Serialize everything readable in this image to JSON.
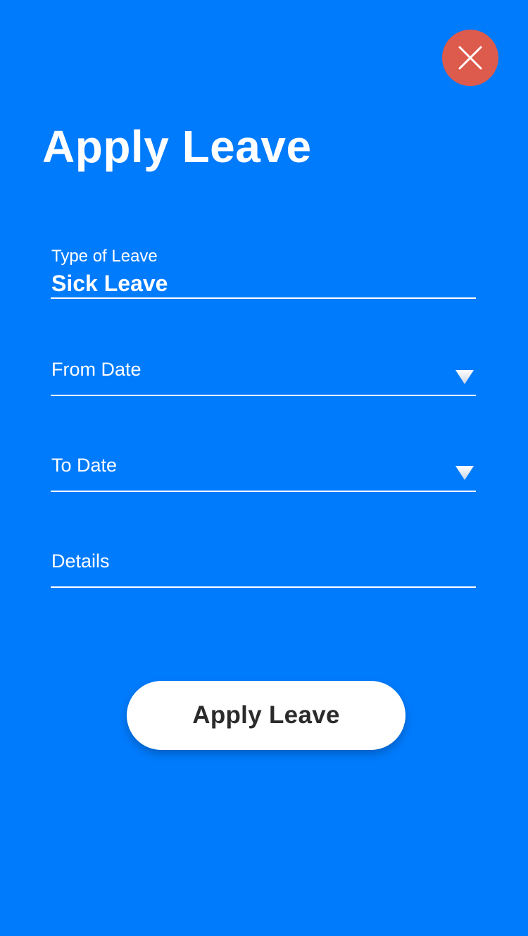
{
  "colors": {
    "background": "#007bfc",
    "close_button": "#dd5b4c",
    "text": "#ffffff",
    "button_bg": "#ffffff",
    "button_text": "#2b2b2b"
  },
  "header": {
    "close_icon": "close-icon",
    "title": "Apply Leave"
  },
  "form": {
    "leave_type": {
      "label": "Type of Leave",
      "value": "Sick Leave"
    },
    "from_date": {
      "placeholder": "From Date",
      "icon": "chevron-down-icon"
    },
    "to_date": {
      "placeholder": "To Date",
      "icon": "chevron-down-icon"
    },
    "details": {
      "placeholder": "Details"
    }
  },
  "submit": {
    "label": "Apply Leave"
  }
}
